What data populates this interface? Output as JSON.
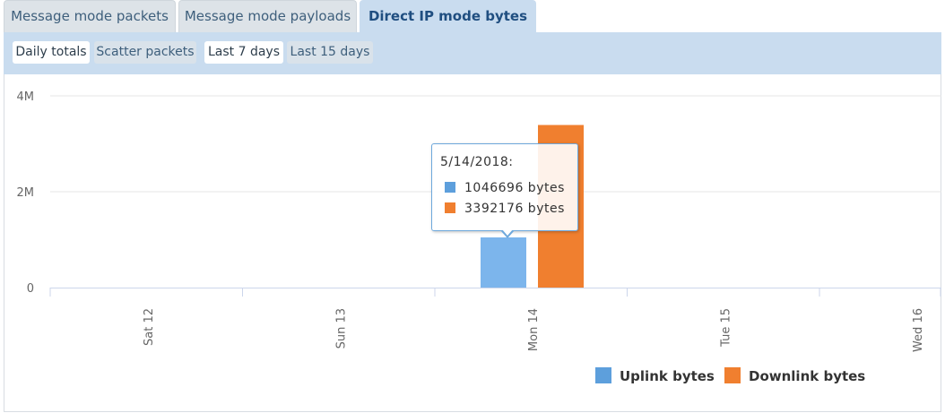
{
  "tabs": [
    {
      "label": "Message mode packets",
      "active": false
    },
    {
      "label": "Message mode payloads",
      "active": false
    },
    {
      "label": "Direct IP mode bytes",
      "active": true
    }
  ],
  "view_options": {
    "daily_totals": "Daily totals",
    "scatter_packets": "Scatter packets",
    "last_7_days": "Last 7 days",
    "last_15_days": "Last 15 days"
  },
  "tooltip": {
    "date": "5/14/2018:",
    "uplink": "1046696 bytes",
    "downlink": "3392176 bytes"
  },
  "colors": {
    "uplink": "#7cb5ec",
    "uplink_legend": "#5d9fdc",
    "downlink": "#f07f2f"
  },
  "chart_data": {
    "type": "bar",
    "categories": [
      "Sat 12",
      "Sun 13",
      "Mon 14",
      "Tue 15",
      "Wed 16"
    ],
    "series": [
      {
        "name": "Uplink bytes",
        "values": [
          0,
          0,
          1046696,
          0,
          0
        ]
      },
      {
        "name": "Downlink bytes",
        "values": [
          0,
          0,
          3392176,
          0,
          0
        ]
      }
    ],
    "y_ticks": [
      {
        "value": 0,
        "label": "0"
      },
      {
        "value": 2000000,
        "label": "2M"
      },
      {
        "value": 4000000,
        "label": "4M"
      }
    ],
    "ylim": [
      0,
      4000000
    ],
    "grid": true,
    "legend_position": "bottom-right"
  }
}
